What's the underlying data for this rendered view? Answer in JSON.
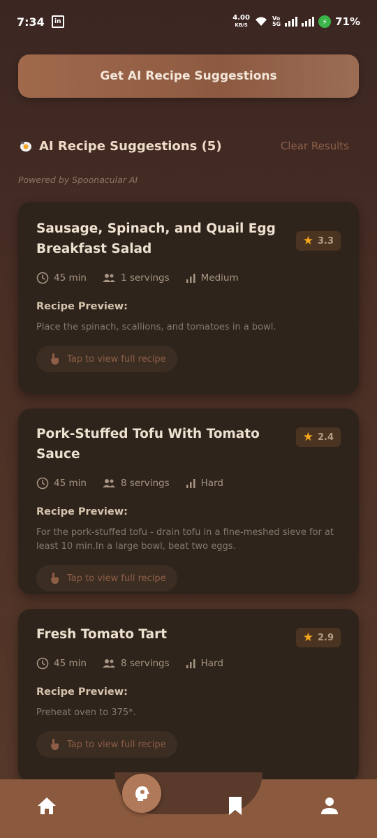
{
  "status_bar": {
    "time": "7:34",
    "speed_value": "4.00",
    "speed_unit": "KB/S",
    "battery": "71%"
  },
  "ai_button_label": "Get AI Recipe Suggestions",
  "section": {
    "title": "AI Recipe Suggestions (5)",
    "clear_label": "Clear Results",
    "powered_by": "Powered by Spoonacular AI"
  },
  "recipes": [
    {
      "title": "Sausage, Spinach, and Quail Egg Breakfast Salad",
      "rating": "3.3",
      "time": "45 min",
      "servings": "1 servings",
      "difficulty": "Medium",
      "preview_label": "Recipe Preview:",
      "preview_text": "Place the spinach, scallions, and tomatoes in a bowl.",
      "tap_label": "Tap to view full recipe"
    },
    {
      "title": "Pork-Stuffed Tofu With Tomato Sauce",
      "rating": "2.4",
      "time": "45 min",
      "servings": "8 servings",
      "difficulty": "Hard",
      "preview_label": "Recipe Preview:",
      "preview_text": "For the pork-stuffed tofu - drain tofu in a fine-meshed sieve for at least 10 min.In a large bowl, beat two eggs.",
      "tap_label": "Tap to view full recipe"
    },
    {
      "title": "Fresh Tomato Tart",
      "rating": "2.9",
      "time": "45 min",
      "servings": "8 servings",
      "difficulty": "Hard",
      "preview_label": "Recipe Preview:",
      "preview_text": "Preheat oven to 375*.",
      "tap_label": "Tap to view full recipe"
    }
  ],
  "nav": {
    "items": [
      "home-icon",
      "ai-chef-icon",
      "bookmark-icon",
      "profile-icon"
    ],
    "colors": {
      "bar": "#8b5a3e",
      "center": "#b07a5a"
    }
  }
}
